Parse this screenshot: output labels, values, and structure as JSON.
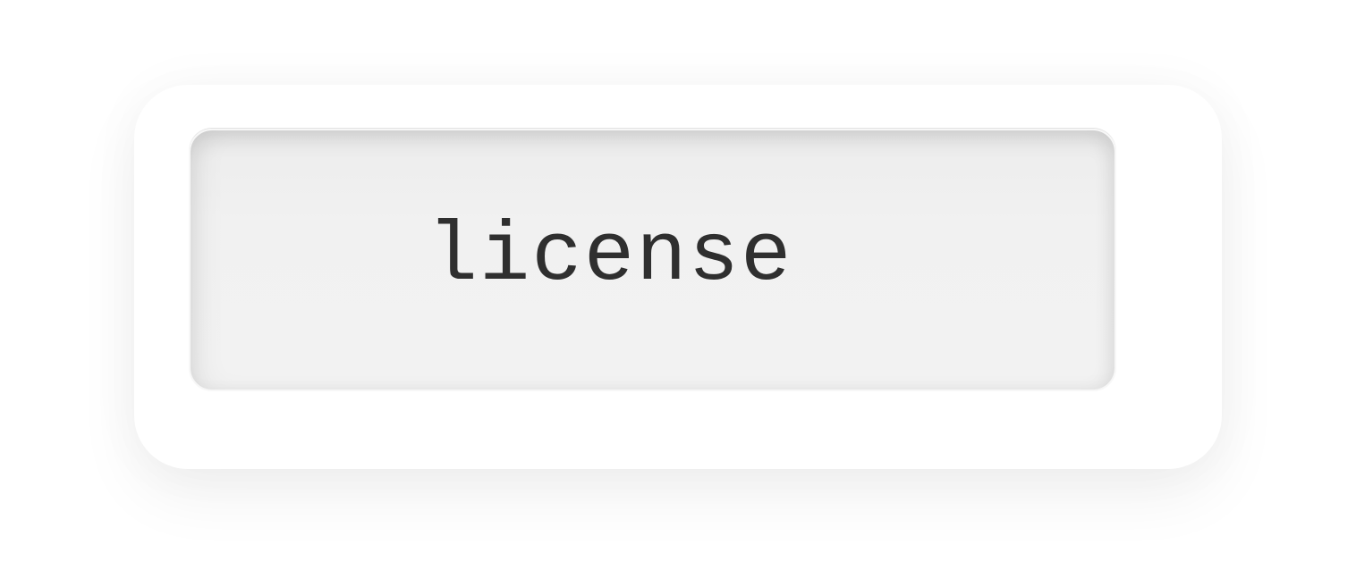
{
  "field": {
    "value": "license"
  },
  "colors": {
    "background": "#ffffff",
    "field_surface": "#f1f1f1",
    "text": "#2f2f2f"
  }
}
